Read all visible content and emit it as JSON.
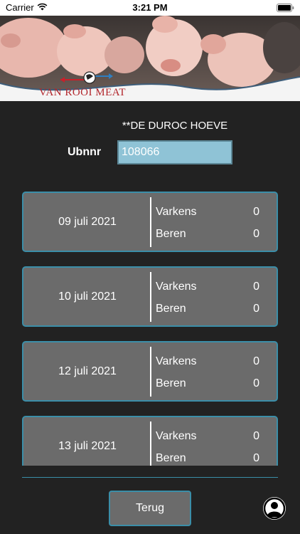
{
  "status_bar": {
    "carrier": "Carrier",
    "time": "3:21 PM"
  },
  "banner": {
    "logo_text": "VAN ROOI MEAT"
  },
  "farm": {
    "name": "**DE DUROC HOEVE"
  },
  "ubn": {
    "label": "Ubnnr",
    "value": "108066"
  },
  "deliveries": [
    {
      "date": "09 juli 2021",
      "varkens_label": "Varkens",
      "varkens": "0",
      "beren_label": "Beren",
      "beren": "0"
    },
    {
      "date": "10 juli 2021",
      "varkens_label": "Varkens",
      "varkens": "0",
      "beren_label": "Beren",
      "beren": "0"
    },
    {
      "date": "12 juli 2021",
      "varkens_label": "Varkens",
      "varkens": "0",
      "beren_label": "Beren",
      "beren": "0"
    },
    {
      "date": "13 juli 2021",
      "varkens_label": "Varkens",
      "varkens": "0",
      "beren_label": "Beren",
      "beren": "0"
    }
  ],
  "footer": {
    "back_label": "Terug"
  },
  "colors": {
    "background": "#222222",
    "card": "#6b6b6b",
    "accent": "#3b8ea8",
    "input": "#8fc3d6",
    "brand_red": "#b2262c"
  },
  "icons": {
    "profile": "user-circle-icon",
    "wifi": "wifi-icon",
    "battery": "battery-icon"
  }
}
